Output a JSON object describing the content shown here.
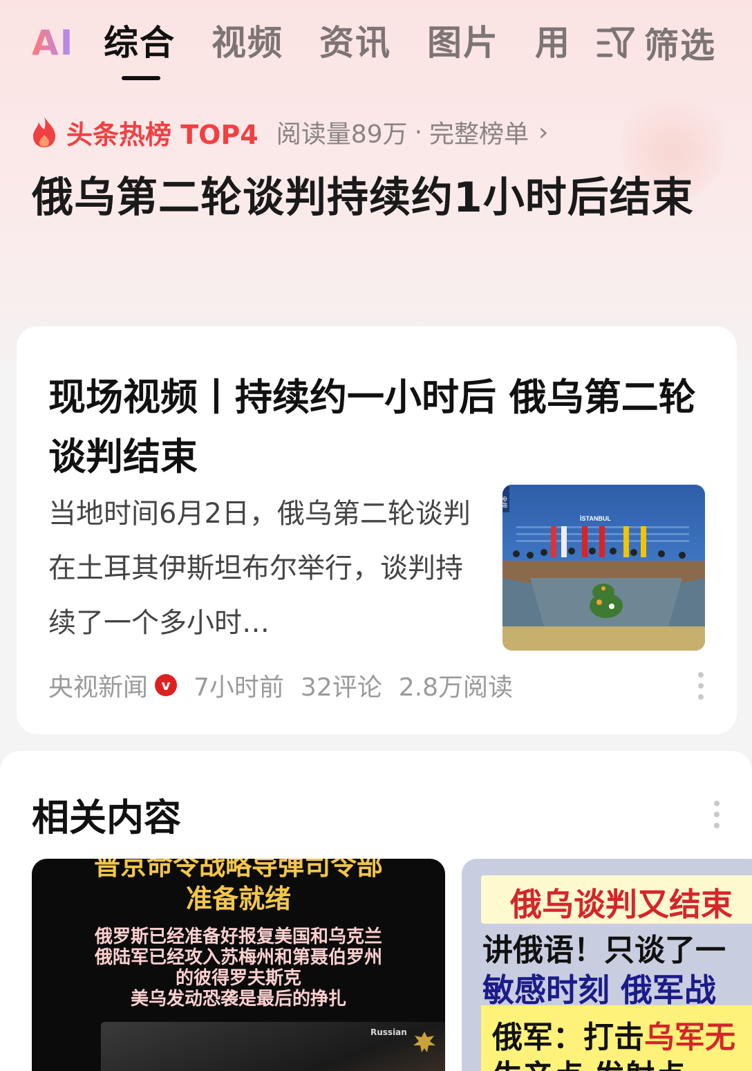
{
  "tabs": {
    "ai": "AI",
    "items": [
      "综合",
      "视频",
      "资讯",
      "图片",
      "用"
    ],
    "active": "综合",
    "filter_label": "筛选"
  },
  "hot": {
    "label": "头条热榜 TOP4",
    "reads": "阅读量89万",
    "separator": "·",
    "full_list": "完整榜单",
    "chevron": "›"
  },
  "headline": "俄乌第二轮谈判持续约1小时后结束",
  "card": {
    "title": "现场视频丨持续约一小时后 俄乌第二轮谈判结束",
    "summary": "当地时间6月2日，俄乌第二轮谈判在土耳其伊斯坦布尔举行，谈判持续了一个多小时…",
    "thumb_text": "İSTANBUL",
    "thumb_side": "央视",
    "source": "央视新闻",
    "verified": "v",
    "time": "7小时前",
    "comments": "32评论",
    "reads": "2.8万阅读"
  },
  "related": {
    "title": "相关内容",
    "card1": {
      "headline_line1": "普京命令战略导弹司令部",
      "headline_line2": "准备就绪",
      "body": [
        "俄罗斯已经准备好报复美国和乌克兰",
        "俄陆军已经攻入苏梅州和第聂伯罗州",
        "的彼得罗夫斯克",
        "美乌发动恐袭是最后的挣扎"
      ],
      "tag": "Russian"
    },
    "card2": {
      "line1": "俄乌谈判又结束",
      "line2": "讲俄语！只谈了一",
      "line3": "敏感时刻 俄军战",
      "line4_a": "俄军：打击",
      "line4_b": "乌军无",
      "line5": "生产点 发射点 ..."
    }
  },
  "colors": {
    "hot_red": "#f04142",
    "verified_red": "#e02020",
    "tab_active": "#111111",
    "tab_inactive": "#7d7474"
  }
}
